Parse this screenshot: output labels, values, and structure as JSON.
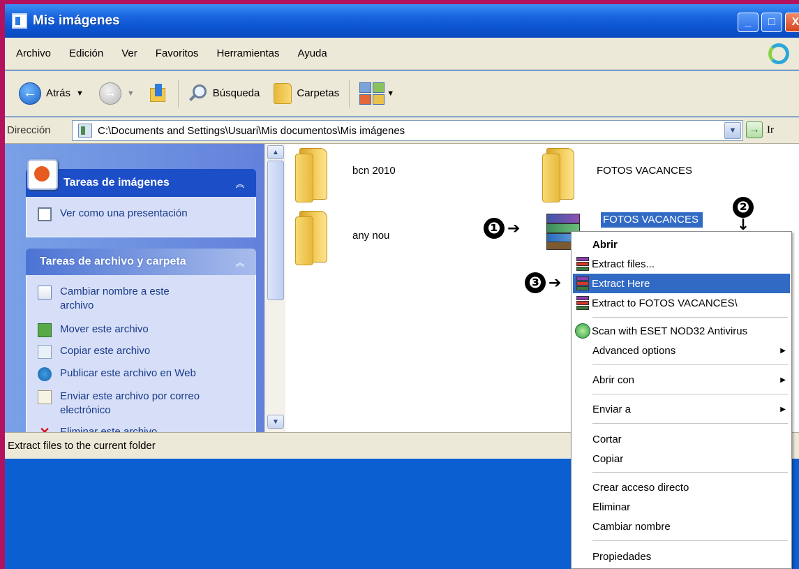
{
  "window": {
    "title": "Mis imágenes",
    "minimize": "_",
    "maximize": "□",
    "close": "X"
  },
  "menubar": {
    "items": [
      "Archivo",
      "Edición",
      "Ver",
      "Favoritos",
      "Herramientas",
      "Ayuda"
    ]
  },
  "toolbar": {
    "back_label": "Atrás",
    "search_label": "Búsqueda",
    "folders_label": "Carpetas"
  },
  "address": {
    "label": "Dirección",
    "value": "C:\\Documents and Settings\\Usuari\\Mis documentos\\Mis imágenes",
    "go_label": "Ir"
  },
  "taskpane": {
    "picture_tasks": {
      "title": "Tareas de imágenes",
      "items": [
        "Ver como una presentación"
      ]
    },
    "file_tasks": {
      "title": "Tareas de archivo y carpeta",
      "items": [
        "Cambiar nombre a este archivo",
        "Mover este archivo",
        "Copiar este archivo",
        "Publicar este archivo en Web",
        "Enviar este archivo por correo electrónico",
        "Eliminar este archivo"
      ]
    }
  },
  "files": [
    {
      "name": "bcn 2010",
      "type": "folder"
    },
    {
      "name": "FOTOS VACANCES",
      "type": "folder"
    },
    {
      "name": "any nou",
      "type": "folder"
    },
    {
      "name": "FOTOS VACANCES",
      "type": "rar",
      "selected": true
    }
  ],
  "status": {
    "text": "Extract files to the current folder"
  },
  "context_menu": {
    "items": [
      {
        "label": "Abrir",
        "bold": true
      },
      {
        "label": "Extract files...",
        "icon": "winrar-icon"
      },
      {
        "label": "Extract Here",
        "icon": "winrar-icon",
        "highlighted": true
      },
      {
        "label": "Extract to FOTOS VACANCES\\",
        "icon": "winrar-icon"
      },
      {
        "label": "Scan with ESET NOD32 Antivirus",
        "icon": "eset-icon"
      },
      {
        "label": "Advanced options",
        "submenu": true
      },
      {
        "label": "Abrir con",
        "submenu": true
      },
      {
        "label": "Enviar a",
        "submenu": true
      },
      {
        "label": "Cortar"
      },
      {
        "label": "Copiar"
      },
      {
        "label": "Crear acceso directo"
      },
      {
        "label": "Eliminar"
      },
      {
        "label": "Cambiar nombre"
      },
      {
        "label": "Propiedades"
      }
    ]
  },
  "callouts": [
    "❶",
    "❷",
    "❸"
  ],
  "colors": {
    "border": "#b3125f",
    "titlebar": "#0c54cf",
    "selection": "#316ac5",
    "chrome": "#ece9d8"
  }
}
